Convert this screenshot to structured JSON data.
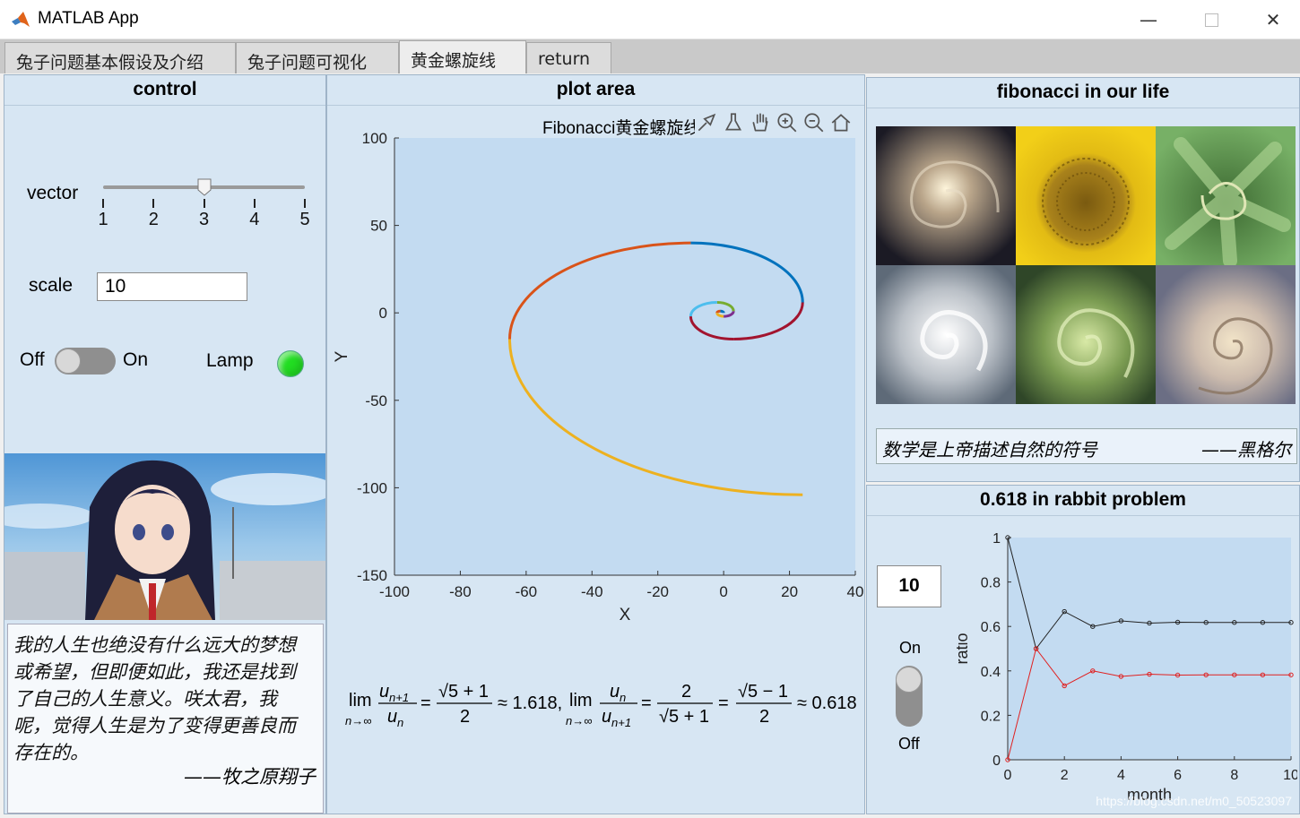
{
  "window": {
    "title": "MATLAB App"
  },
  "tabs": [
    "兔子问题基本假设及介绍",
    "兔子问题可视化",
    "黄金螺旋线",
    "return"
  ],
  "control": {
    "title": "control",
    "slider_label": "vector",
    "slider_ticks": [
      "1",
      "2",
      "3",
      "4",
      "5"
    ],
    "slider_value": 3,
    "scale_label": "scale",
    "scale_value": "10",
    "switch_off": "Off",
    "switch_on": "On",
    "lamp_label": "Lamp",
    "lamp_color": "#22dd22",
    "quote_lines": [
      "我的人生也绝没有什么远大的梦想",
      "或希望，但即便如此，我还是找到",
      "了自己的人生意义。咲太君，我",
      "呢，觉得人生是为了变得更善良而",
      "存在的。"
    ],
    "quote_author": "——牧之原翔子"
  },
  "plot": {
    "title": "plot area",
    "chart_title": "Fibonacci黄金螺旋线",
    "toolbar_icons": [
      "brush-data-icon",
      "clean-icon",
      "pan-hand-icon",
      "zoom-in-icon",
      "zoom-out-icon",
      "home-icon"
    ],
    "formula": {
      "lim1_num": "u",
      "lim1_sub_num": "n+1",
      "lim1_den": "u",
      "lim1_sub_den": "n",
      "phi_num": "√5 + 1",
      "phi_den": "2",
      "approx1": "≈ 1.618,",
      "lim2_num": "u",
      "lim2_sub_num": "n",
      "lim2_den": "u",
      "lim2_sub_den": "n+1",
      "frac2_num": "2",
      "frac2_den": "√5 + 1",
      "frac3_num": "√5 − 1",
      "frac3_den": "2",
      "approx2": "≈ 0.618",
      "lim": "lim",
      "lim_sub": "n→∞"
    }
  },
  "fib_life": {
    "title": "fibonacci in our life",
    "images": [
      "spiral-galaxy",
      "sunflower",
      "leaf-spiral",
      "hurricane",
      "succulent",
      "nautilus-shell"
    ],
    "quote": "数学是上帝描述自然的符号",
    "quote_author": "——黑格尔"
  },
  "rabbit": {
    "title": "0.618 in rabbit problem",
    "input_value": "10",
    "switch_on": "On",
    "switch_off": "Off",
    "watermark": "https://blog.csdn.net/m0_50523097"
  },
  "chart_data": [
    {
      "type": "line",
      "title": "Fibonacci黄金螺旋线",
      "xlabel": "X",
      "ylabel": "Y",
      "xlim": [
        -100,
        40
      ],
      "ylim": [
        -150,
        100
      ],
      "xticks": [
        -100,
        -80,
        -60,
        -40,
        -20,
        0,
        20,
        40
      ],
      "yticks": [
        100,
        50,
        0,
        -50,
        -100,
        -150
      ],
      "segments": [
        {
          "color": "#0072bd",
          "center": [
            -1,
            0
          ],
          "radius": 1,
          "start_deg": 0,
          "end_deg": 90
        },
        {
          "color": "#d95319",
          "center": [
            -1,
            0
          ],
          "radius": 1,
          "start_deg": 90,
          "end_deg": 180
        },
        {
          "color": "#edb120",
          "center": [
            0,
            0
          ],
          "radius": 2,
          "start_deg": 180,
          "end_deg": 270
        },
        {
          "color": "#7e2f8e",
          "center": [
            0,
            1
          ],
          "radius": 3,
          "start_deg": 270,
          "end_deg": 360
        },
        {
          "color": "#77ac30",
          "center": [
            -2,
            1
          ],
          "radius": 5,
          "start_deg": 0,
          "end_deg": 90
        },
        {
          "color": "#4dbeee",
          "center": [
            -2,
            -2
          ],
          "radius": 8,
          "start_deg": 90,
          "end_deg": 180
        },
        {
          "color": "#a2142f",
          "center": [
            3,
            -2
          ],
          "radius": 13,
          "start_deg": 180,
          "end_deg": 270
        },
        {
          "color": "#a2142f",
          "center": [
            3,
            6
          ],
          "radius": 21,
          "start_deg": 270,
          "end_deg": 360
        },
        {
          "color": "#0072bd",
          "center": [
            -10,
            6
          ],
          "radius": 34,
          "start_deg": 0,
          "end_deg": 90
        },
        {
          "color": "#d95319",
          "center": [
            -10,
            -15
          ],
          "radius": 55,
          "start_deg": 90,
          "end_deg": 180
        },
        {
          "color": "#edb120",
          "center": [
            24,
            -15
          ],
          "radius": 89,
          "start_deg": 180,
          "end_deg": 270
        }
      ]
    },
    {
      "type": "line",
      "title": "",
      "xlabel": "month",
      "ylabel": "ratio",
      "xlim": [
        0,
        10
      ],
      "ylim": [
        0,
        1
      ],
      "xticks": [
        0,
        2,
        4,
        6,
        8,
        10
      ],
      "yticks": [
        0,
        0.2,
        0.4,
        0.6,
        0.8,
        1
      ],
      "x": [
        0,
        1,
        2,
        3,
        4,
        5,
        6,
        7,
        8,
        9,
        10
      ],
      "series": [
        {
          "color": "#222222",
          "values": [
            1,
            0.5,
            0.667,
            0.6,
            0.625,
            0.615,
            0.619,
            0.618,
            0.618,
            0.618,
            0.618
          ]
        },
        {
          "color": "#e02020",
          "values": [
            0,
            0.5,
            0.333,
            0.4,
            0.375,
            0.385,
            0.381,
            0.382,
            0.382,
            0.382,
            0.382
          ]
        }
      ]
    }
  ]
}
